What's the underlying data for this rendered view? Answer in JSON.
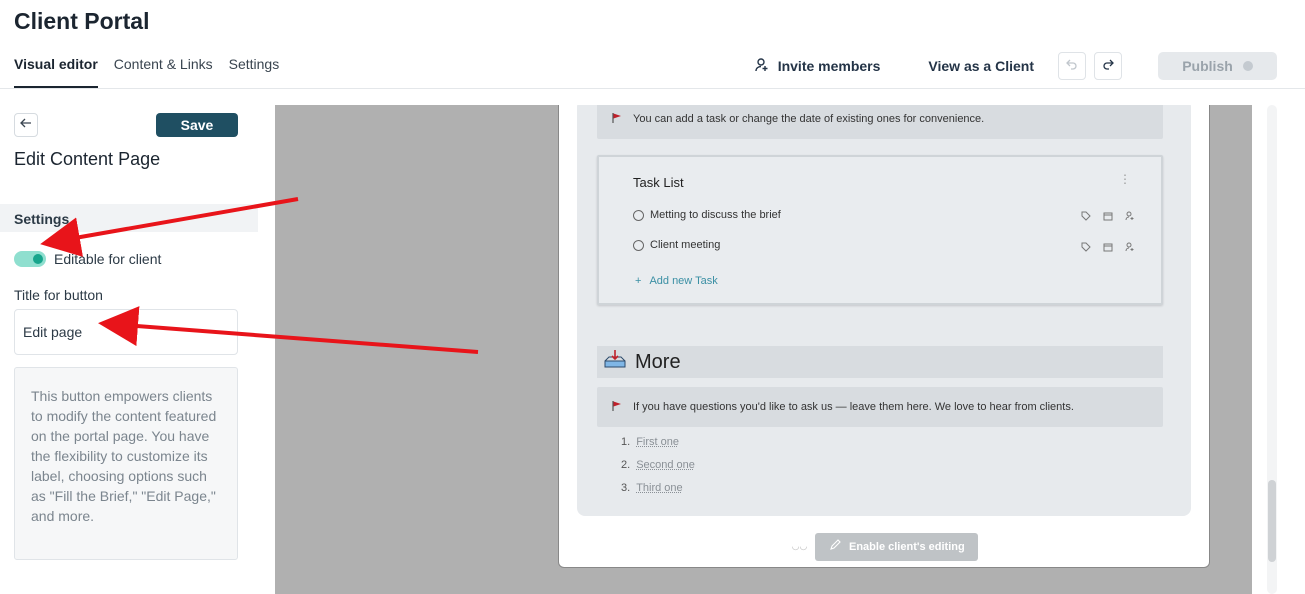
{
  "app": {
    "title": "Client Portal"
  },
  "tabs": [
    {
      "label": "Visual editor",
      "active": true
    },
    {
      "label": "Content & Links",
      "active": false
    },
    {
      "label": "Settings",
      "active": false
    }
  ],
  "header": {
    "invite_label": "Invite members",
    "invite_icon": "add-person-icon",
    "view_as_client_label": "View as a Client",
    "undo_icon": "undo-icon",
    "redo_icon": "redo-icon",
    "publish_label": "Publish"
  },
  "left_panel": {
    "back_icon": "arrow-left-icon",
    "save_label": "Save",
    "title": "Edit Content Page",
    "settings_label": "Settings",
    "toggle_label": "Editable for client",
    "toggle_on": true,
    "title_for_button_label": "Title for button",
    "title_input_value": "Edit page",
    "info_text": "This button empowers clients to modify the content featured on the portal page. You have the flexibility to customize its label, choosing options such as \"Fill the Brief,\" \"Edit Page,\" and more."
  },
  "preview": {
    "note_top": "You can add a task or change the date of existing ones for convenience.",
    "task_list": {
      "title": "Task List",
      "tasks": [
        {
          "label": "Metting to discuss the brief"
        },
        {
          "label": "Client meeting"
        }
      ],
      "add_label": "Add new Task"
    },
    "more_title": "More",
    "note_more": "If you have questions you'd like to ask us — leave them here. We love to hear from clients.",
    "list": [
      {
        "num": "1.",
        "label": "First one"
      },
      {
        "num": "2.",
        "label": "Second one"
      },
      {
        "num": "3.",
        "label": "Third one"
      }
    ],
    "enable_label": "Enable client's editing"
  },
  "colors": {
    "save_bg": "#1f4f62",
    "toggle_accent": "#17a58c",
    "annotation_arrow": "#e8141a"
  }
}
